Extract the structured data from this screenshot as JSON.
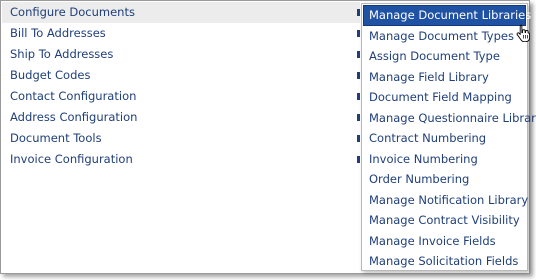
{
  "menu": {
    "items": [
      {
        "label": "Configure Documents",
        "active": true,
        "has_submenu": true
      },
      {
        "label": "Bill To Addresses",
        "has_submenu": true
      },
      {
        "label": "Ship To Addresses",
        "has_submenu": true
      },
      {
        "label": "Budget Codes",
        "has_submenu": true
      },
      {
        "label": "Contact Configuration",
        "has_submenu": true
      },
      {
        "label": "Address Configuration",
        "has_submenu": true
      },
      {
        "label": "Document Tools",
        "has_submenu": true
      },
      {
        "label": "Invoice Configuration",
        "has_submenu": true
      }
    ]
  },
  "submenu": {
    "items": [
      {
        "label": "Manage Document Libraries",
        "active": true
      },
      {
        "label": "Manage Document Types"
      },
      {
        "label": "Assign Document Type"
      },
      {
        "label": "Manage Field Library"
      },
      {
        "label": "Document Field Mapping"
      },
      {
        "label": "Manage Questionnaire Library"
      },
      {
        "label": "Contract Numbering"
      },
      {
        "label": "Invoice Numbering"
      },
      {
        "label": "Order Numbering"
      },
      {
        "label": "Manage Notification Library"
      },
      {
        "label": "Manage Contract Visibility"
      },
      {
        "label": "Manage Invoice Fields"
      },
      {
        "label": "Manage Solicitation Fields"
      }
    ]
  },
  "colors": {
    "link_text": "#1f3f7a",
    "highlight_bg": "#1f52a3",
    "hover_row_bg": "#ececec"
  },
  "icons": {
    "cursor": "hand-pointer-icon",
    "submenu_indicator": "submenu-arrow-icon"
  }
}
